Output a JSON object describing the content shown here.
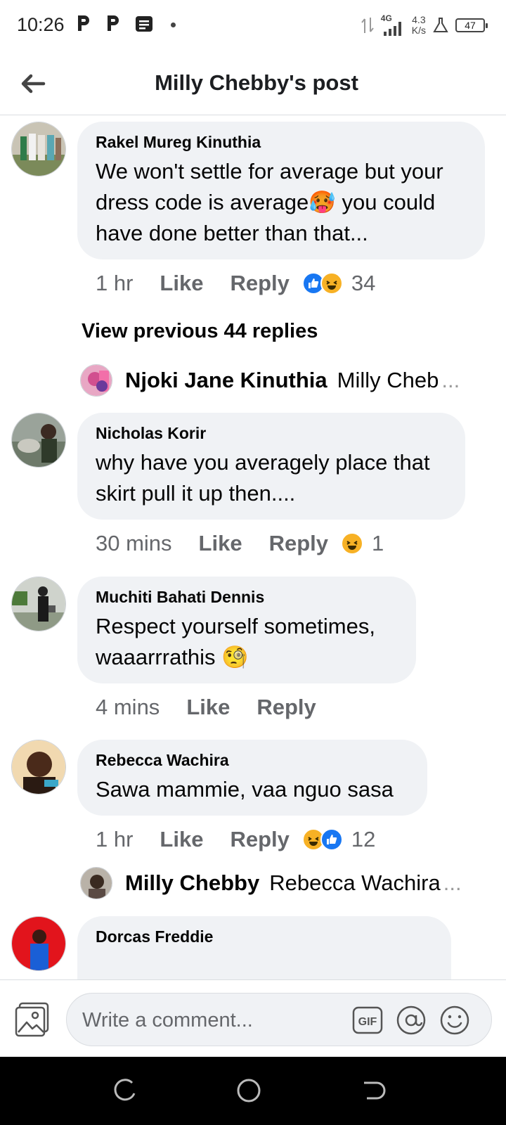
{
  "status_bar": {
    "time": "10:26",
    "network": "4G",
    "speed_value": "4.3",
    "speed_unit": "K/s",
    "battery": "47"
  },
  "header": {
    "title": "Milly Chebby's post",
    "back_icon": "arrow-left-icon"
  },
  "comments": [
    {
      "author": "Rakel Mureg Kinuthia",
      "line1": "We won't settle for average but your",
      "line2": "dress code is average🥵 you could",
      "line3": "have done better than that...",
      "time": "1 hr",
      "like": "Like",
      "reply": "Reply",
      "reactions": [
        "like",
        "haha"
      ],
      "reaction_count": "34"
    },
    {
      "author": "Nicholas Korir",
      "line1": "why have you averagely place that",
      "line2": "skirt pull it up then....",
      "time": "30 mins",
      "like": "Like",
      "reply": "Reply",
      "reactions": [
        "haha"
      ],
      "reaction_count": "1"
    },
    {
      "author": "Muchiti Bahati Dennis",
      "line1": "Respect yourself sometimes,",
      "line2": "waaarrrathis 🧐",
      "time": "4 mins",
      "like": "Like",
      "reply": "Reply"
    },
    {
      "author": "Rebecca Wachira",
      "line1": "Sawa mammie, vaa nguo sasa",
      "time": "1 hr",
      "like": "Like",
      "reply": "Reply",
      "reactions": [
        "haha",
        "like"
      ],
      "reaction_count": "12"
    },
    {
      "author": "Dorcas Freddie"
    }
  ],
  "view_previous": "View previous 44 replies",
  "reply_previews": [
    {
      "author": "Njoki Jane Kinuthia",
      "text": "Milly Cheb",
      "ellipsis": "..."
    },
    {
      "author": "Milly Chebby",
      "text": "Rebecca Wachira",
      "ellipsis": "..."
    }
  ],
  "composer": {
    "placeholder": "Write a comment...",
    "gif_label": "GIF"
  },
  "colors": {
    "bubble": "#f0f2f5",
    "secondary_text": "#65676b",
    "like_blue": "#1877f2",
    "haha_yellow": "#f7b125"
  }
}
